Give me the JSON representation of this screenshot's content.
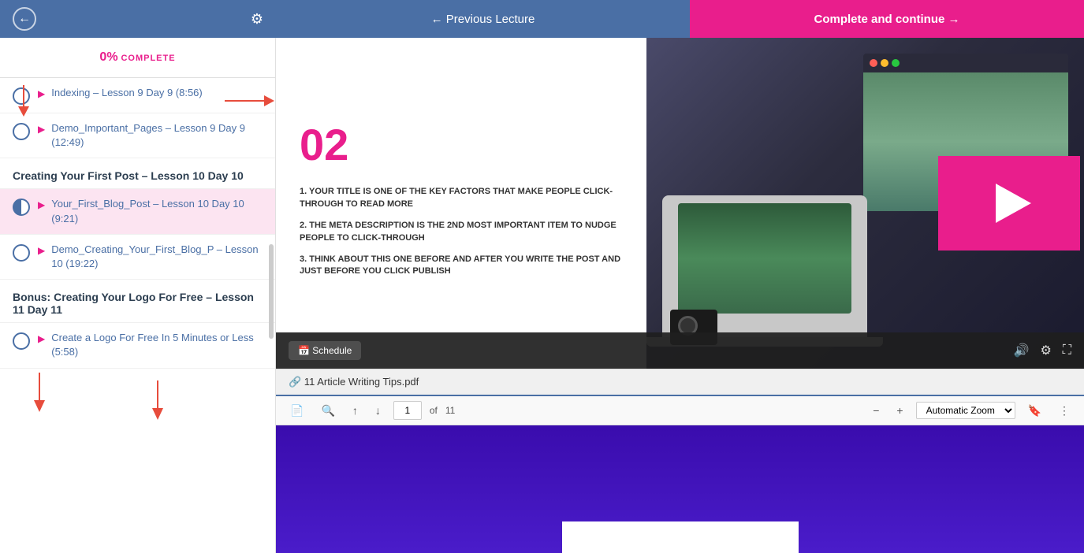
{
  "nav": {
    "prev_label": "← Previous Lecture",
    "complete_label": "Complete and continue →"
  },
  "sidebar": {
    "progress_percent": "0%",
    "progress_label": "COMPLETE",
    "lessons": [
      {
        "id": "indexing",
        "circle": "empty",
        "icon": "▶",
        "text": "Indexing – Lesson 9 Day 9 (8:56)"
      },
      {
        "id": "demo-important",
        "circle": "empty",
        "icon": "▶",
        "text": "Demo_Important_Pages – Lesson 9 Day 9 (12:49)"
      }
    ],
    "section_creating": "Creating Your First Post – Lesson 10 Day 10",
    "lessons_creating": [
      {
        "id": "your-first-blog",
        "circle": "half",
        "icon": "▶",
        "text": "Your_First_Blog_Post – Lesson 10 Day 10 (9:21)",
        "active": true
      },
      {
        "id": "demo-creating",
        "circle": "empty",
        "icon": "▶",
        "text": "Demo_Creating_Your_First_Blog_P – Lesson 10 (19:22)"
      }
    ],
    "section_bonus": "Bonus: Creating Your Logo For Free – Lesson 11 Day 11",
    "lessons_bonus": [
      {
        "id": "create-logo",
        "circle": "empty",
        "icon": "▶",
        "text": "Create a Logo For Free In 5 Minutes or Less (5:58)"
      }
    ]
  },
  "video": {
    "slide_number": "02",
    "points": [
      "1. YOUR TITLE IS ONE OF THE KEY FACTORS THAT MAKE PEOPLE CLICK-THROUGH TO READ MORE",
      "2. THE META DESCRIPTION IS THE 2ND MOST IMPORTANT ITEM TO NUDGE PEOPLE TO CLICK-THROUGH",
      "3. THINK ABOUT THIS ONE BEFORE AND AFTER YOU WRITE THE POST AND JUST BEFORE YOU CLICK PUBLISH"
    ],
    "schedule_label": "📅 Schedule"
  },
  "pdf": {
    "tab_label": "🔗 11 Article Writing Tips.pdf",
    "page_current": "1",
    "page_total": "11",
    "zoom_label": "Automatic Zoom"
  }
}
